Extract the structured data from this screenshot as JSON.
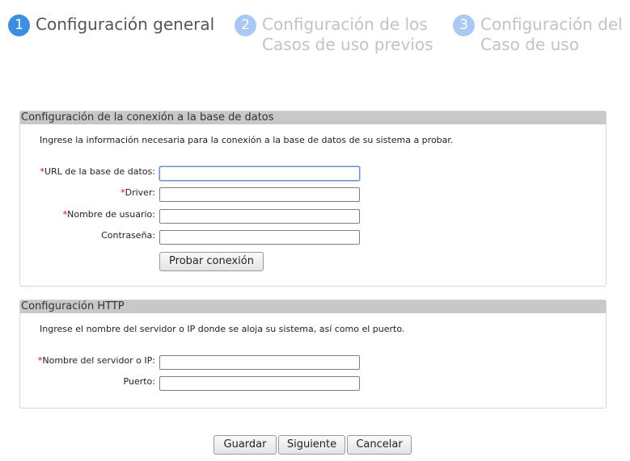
{
  "wizard": {
    "steps": [
      {
        "number": "1",
        "label": "Configuración general"
      },
      {
        "number": "2",
        "label": "Configuración de los\nCasos de uso previos"
      },
      {
        "number": "3",
        "label": "Configuración del\nCaso de uso"
      }
    ]
  },
  "db": {
    "legend": "Configuración de la conexión a la base de datos",
    "description": "Ingrese la información necesaria para la conexión a la base de datos de su sistema a probar.",
    "url_label": "URL de la base de datos:",
    "driver_label": "Driver:",
    "user_label": "Nombre de usuario:",
    "password_label": "Contraseña:",
    "required_mark": "*",
    "url_value": "",
    "driver_value": "",
    "user_value": "",
    "password_value": "",
    "test_button": "Probar conexión"
  },
  "http": {
    "legend": "Configuración HTTP",
    "description": "Ingrese el nombre del servidor o IP donde se aloja su sistema, así como el puerto.",
    "server_label": "Nombre del servidor o IP:",
    "port_label": "Puerto:",
    "required_mark": "*",
    "server_value": "",
    "port_value": ""
  },
  "actions": {
    "save": "Guardar",
    "next": "Siguiente",
    "cancel": "Cancelar"
  }
}
